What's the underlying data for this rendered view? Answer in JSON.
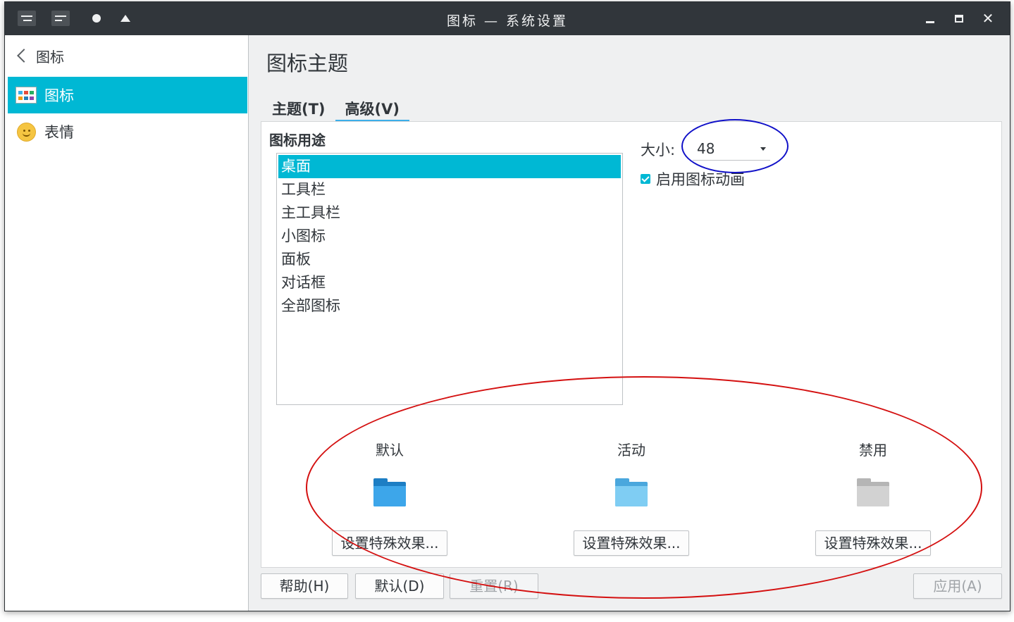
{
  "window": {
    "title": "图标 — 系统设置"
  },
  "sidebar": {
    "header_label": "图标",
    "items": [
      {
        "label": "图标",
        "icon": "icons-grid-icon",
        "active": true
      },
      {
        "label": "表情",
        "icon": "smiley-icon",
        "active": false
      }
    ]
  },
  "main": {
    "page_title": "图标主题",
    "tabs": [
      {
        "label": "主题(T)",
        "active": false
      },
      {
        "label": "高级(V)",
        "active": true
      }
    ],
    "usage_group_title": "图标用途",
    "usage_items": [
      "桌面",
      "工具栏",
      "主工具栏",
      "小图标",
      "面板",
      "对话框",
      "全部图标"
    ],
    "selected_usage": "桌面",
    "size_label": "大小:",
    "size_value": "48",
    "animate_label": "启用图标动画",
    "animate_checked": true,
    "previews": [
      {
        "caption": "默认",
        "button": "设置特殊效果...",
        "icon": "folder-default-icon"
      },
      {
        "caption": "活动",
        "button": "设置特殊效果...",
        "icon": "folder-active-icon"
      },
      {
        "caption": "禁用",
        "button": "设置特殊效果...",
        "icon": "folder-disabled-icon"
      }
    ]
  },
  "footer": {
    "help": "帮助(H)",
    "defaults": "默认(D)",
    "reset": "重置(R)",
    "apply": "应用(A)"
  },
  "colors": {
    "accent": "#00b8d4",
    "titlebar": "#31363b",
    "annotation_blue": "#1010c8",
    "annotation_red": "#d41010"
  }
}
